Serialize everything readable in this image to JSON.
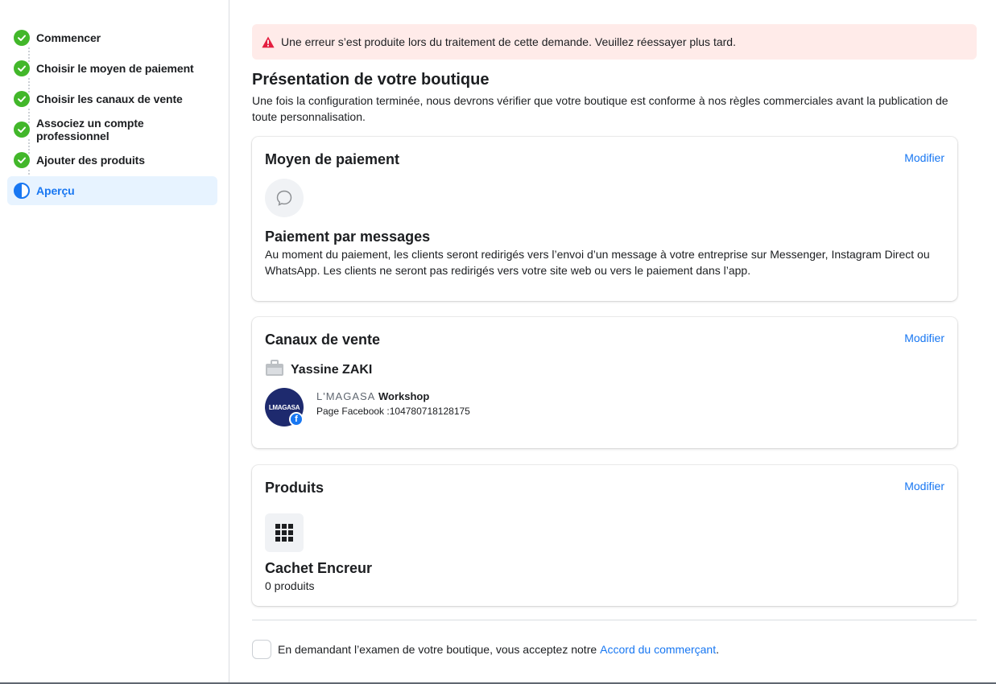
{
  "sidebar": {
    "steps": [
      {
        "label": "Commencer",
        "status": "done"
      },
      {
        "label": "Choisir le moyen de paiement",
        "status": "done"
      },
      {
        "label": "Choisir les canaux de vente",
        "status": "done"
      },
      {
        "label": "Associez un compte professionnel",
        "status": "done"
      },
      {
        "label": "Ajouter des produits",
        "status": "done"
      },
      {
        "label": "Aperçu",
        "status": "active"
      }
    ]
  },
  "error": {
    "icon": "warning-icon",
    "message": "Une erreur s’est produite lors du traitement de cette demande. Veuillez réessayer plus tard."
  },
  "main": {
    "title": "Présentation de votre boutique",
    "subtitle": "Une fois la configuration terminée, nous devrons vérifier que votre boutique est conforme à nos règles commerciales avant la publication de toute personnalisation."
  },
  "payment": {
    "title": "Moyen de paiement",
    "modify": "Modifier",
    "icon": "chat-bubble-icon",
    "method_title": "Paiement par messages",
    "method_desc": "Au moment du paiement, les clients seront redirigés vers l’envoi d’un message à votre entreprise sur Messenger, Instagram Direct ou WhatsApp. Les clients ne seront pas redirigés vers votre site web ou vers le paiement dans l’app."
  },
  "channels": {
    "title": "Canaux de vente",
    "modify": "Modifier",
    "owner_icon": "briefcase-icon",
    "owner_name": "Yassine ZAKI",
    "page": {
      "avatar_text": "LMAGASA",
      "name_part1": "L'MAGASA",
      "name_part2": "Workshop",
      "id_text": "Page Facebook :104780718128175"
    }
  },
  "products": {
    "title": "Produits",
    "modify": "Modifier",
    "icon": "grid-icon",
    "catalog_name": "Cachet Encreur",
    "count": "0 produits"
  },
  "terms": {
    "text": "En demandant l’examen de votre boutique, vous acceptez notre",
    "link": "Accord du commerçant",
    "suffix": "."
  },
  "colors": {
    "accent": "#1877f2",
    "success": "#42b72a",
    "error_bg": "#ffebe9",
    "error_icon": "#e41e3f"
  }
}
